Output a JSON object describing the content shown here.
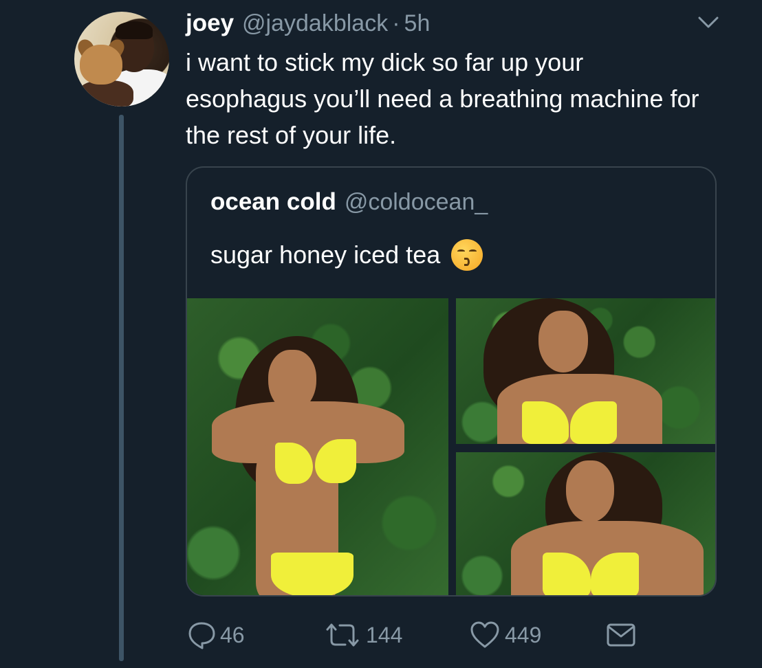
{
  "tweet": {
    "author_name": "joey",
    "author_handle": "@jaydakblack",
    "separator": "·",
    "timestamp": "5h",
    "text": "i want to stick my dick so far up your esophagus you’ll need a breathing machine for the rest of your life."
  },
  "quoted_tweet": {
    "author_name": "ocean cold",
    "author_handle": "@coldocean_",
    "text": "sugar honey iced tea",
    "emoji": "kissing-face-with-closed-eyes"
  },
  "actions": {
    "reply_count": "46",
    "retweet_count": "144",
    "like_count": "449"
  },
  "icons": {
    "menu": "chevron-down-icon",
    "reply": "reply-icon",
    "retweet": "retweet-icon",
    "like": "heart-icon",
    "dm": "envelope-icon"
  },
  "colors": {
    "background": "#15202b",
    "secondary_text": "#8899a6",
    "border": "#38444d",
    "thread_line": "#3d5466"
  }
}
